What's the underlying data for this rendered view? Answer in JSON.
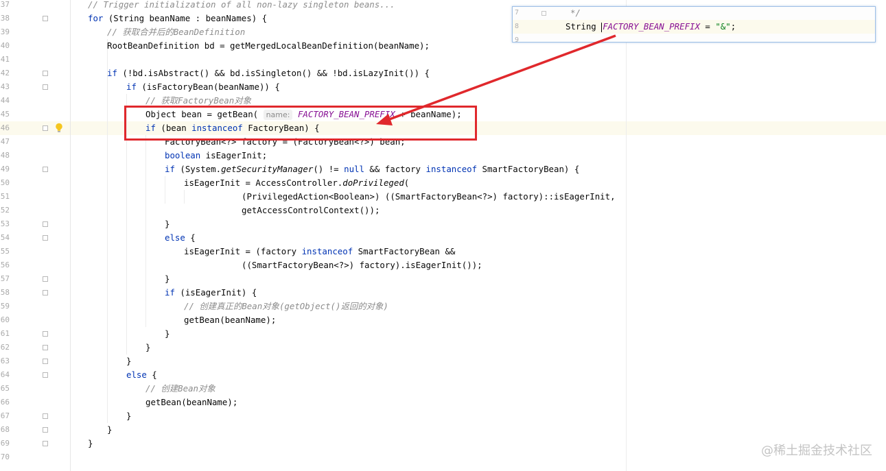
{
  "editor": {
    "lines": [
      {
        "num": "37",
        "segs": [
          {
            "t": "// Trigger initialization of all non-lazy singleton beans...",
            "c": "cm"
          }
        ]
      },
      {
        "num": "38",
        "segs": [
          {
            "t": "for",
            "c": "kw"
          },
          {
            "t": " (String beanName : beanNames) {",
            "c": ""
          }
        ]
      },
      {
        "num": "39",
        "segs": [
          {
            "t": "// 获取合并后的BeanDefinition",
            "c": "cm"
          }
        ]
      },
      {
        "num": "40",
        "segs": [
          {
            "t": "RootBeanDefinition bd = getMergedLocalBeanDefinition(beanName);",
            "c": ""
          }
        ]
      },
      {
        "num": "41",
        "segs": []
      },
      {
        "num": "42",
        "segs": [
          {
            "t": "if",
            "c": "kw"
          },
          {
            "t": " (!bd.isAbstract() && bd.isSingleton() && !bd.isLazyInit()) {",
            "c": ""
          }
        ]
      },
      {
        "num": "43",
        "segs": [
          {
            "t": "if",
            "c": "kw"
          },
          {
            "t": " (isFactoryBean(beanName)) {",
            "c": ""
          }
        ]
      },
      {
        "num": "44",
        "segs": [
          {
            "t": "// 获取FactoryBean对象",
            "c": "cm"
          }
        ]
      },
      {
        "num": "45",
        "segs": [
          {
            "t": "Object bean = getBean( ",
            "c": ""
          },
          {
            "t": "name:",
            "c": "hint"
          },
          {
            "t": " ",
            "c": ""
          },
          {
            "t": "FACTORY_BEAN_PREFIX",
            "c": "cn"
          },
          {
            "t": " + beanName);",
            "c": ""
          }
        ]
      },
      {
        "num": "46",
        "segs": [
          {
            "t": "if",
            "c": "kw"
          },
          {
            "t": " (bean ",
            "c": ""
          },
          {
            "t": "instanceof",
            "c": "kw"
          },
          {
            "t": " FactoryBean) {",
            "c": ""
          }
        ]
      },
      {
        "num": "47",
        "segs": [
          {
            "t": "FactoryBean<?> factory = (FactoryBean<?>) bean;",
            "c": ""
          }
        ]
      },
      {
        "num": "48",
        "segs": [
          {
            "t": "boolean",
            "c": "kw"
          },
          {
            "t": " isEagerInit;",
            "c": ""
          }
        ]
      },
      {
        "num": "49",
        "segs": [
          {
            "t": "if",
            "c": "kw"
          },
          {
            "t": " (System.",
            "c": ""
          },
          {
            "t": "getSecurityManager",
            "c": "it"
          },
          {
            "t": "() != ",
            "c": ""
          },
          {
            "t": "null",
            "c": "kw"
          },
          {
            "t": " && factory ",
            "c": ""
          },
          {
            "t": "instanceof",
            "c": "kw"
          },
          {
            "t": " SmartFactoryBean) {",
            "c": ""
          }
        ]
      },
      {
        "num": "50",
        "segs": [
          {
            "t": "isEagerInit = AccessController.",
            "c": ""
          },
          {
            "t": "doPrivileged",
            "c": "it"
          },
          {
            "t": "(",
            "c": ""
          }
        ]
      },
      {
        "num": "51",
        "segs": [
          {
            "t": "(PrivilegedAction<Boolean>) ((SmartFactoryBean<?>) factory)::isEagerInit,",
            "c": ""
          }
        ]
      },
      {
        "num": "52",
        "segs": [
          {
            "t": "getAccessControlContext());",
            "c": ""
          }
        ]
      },
      {
        "num": "53",
        "segs": [
          {
            "t": "}",
            "c": ""
          }
        ]
      },
      {
        "num": "54",
        "segs": [
          {
            "t": "else",
            "c": "kw"
          },
          {
            "t": " {",
            "c": ""
          }
        ]
      },
      {
        "num": "55",
        "segs": [
          {
            "t": "isEagerInit = (factory ",
            "c": ""
          },
          {
            "t": "instanceof",
            "c": "kw"
          },
          {
            "t": " SmartFactoryBean &&",
            "c": ""
          }
        ]
      },
      {
        "num": "56",
        "segs": [
          {
            "t": "((SmartFactoryBean<?>) factory).isEagerInit());",
            "c": ""
          }
        ]
      },
      {
        "num": "57",
        "segs": [
          {
            "t": "}",
            "c": ""
          }
        ]
      },
      {
        "num": "58",
        "segs": [
          {
            "t": "if",
            "c": "kw"
          },
          {
            "t": " (isEagerInit) {",
            "c": ""
          }
        ]
      },
      {
        "num": "59",
        "segs": [
          {
            "t": "// 创建真正的Bean对象(getObject()返回的对象)",
            "c": "cm"
          }
        ]
      },
      {
        "num": "60",
        "segs": [
          {
            "t": "getBean(beanName);",
            "c": ""
          }
        ]
      },
      {
        "num": "61",
        "segs": [
          {
            "t": "}",
            "c": ""
          }
        ]
      },
      {
        "num": "62",
        "segs": [
          {
            "t": "}",
            "c": ""
          }
        ]
      },
      {
        "num": "63",
        "segs": [
          {
            "t": "}",
            "c": ""
          }
        ]
      },
      {
        "num": "64",
        "segs": [
          {
            "t": "else",
            "c": "kw"
          },
          {
            "t": " {",
            "c": ""
          }
        ]
      },
      {
        "num": "65",
        "segs": [
          {
            "t": "// 创建Bean对象",
            "c": "cm"
          }
        ]
      },
      {
        "num": "66",
        "segs": [
          {
            "t": "getBean(beanName);",
            "c": ""
          }
        ]
      },
      {
        "num": "67",
        "segs": [
          {
            "t": "}",
            "c": ""
          }
        ]
      },
      {
        "num": "68",
        "segs": [
          {
            "t": "}",
            "c": ""
          }
        ]
      },
      {
        "num": "69",
        "segs": [
          {
            "t": "}",
            "c": ""
          }
        ]
      },
      {
        "num": "70",
        "segs": []
      }
    ]
  },
  "popup": {
    "lines": [
      {
        "num": "7",
        "segs": [
          {
            "t": "*/",
            "c": "cm"
          }
        ]
      },
      {
        "num": "8",
        "segs": [
          {
            "t": "String ",
            "c": ""
          },
          {
            "t": "FACTORY_BEAN_PREFIX",
            "c": "cn"
          },
          {
            "t": " = ",
            "c": ""
          },
          {
            "t": "\"&\"",
            "c": "st"
          },
          {
            "t": ";",
            "c": ""
          }
        ]
      },
      {
        "num": "9",
        "segs": []
      }
    ]
  },
  "icons": {
    "bulb": "lightbulb-icon",
    "fold": "fold-marker-icon"
  },
  "colors": {
    "keyword": "#0033b3",
    "comment": "#8c8c8c",
    "constant": "#871094",
    "string": "#067d17",
    "annotation_red": "#e0282c"
  },
  "watermark": "@稀土掘金技术社区"
}
